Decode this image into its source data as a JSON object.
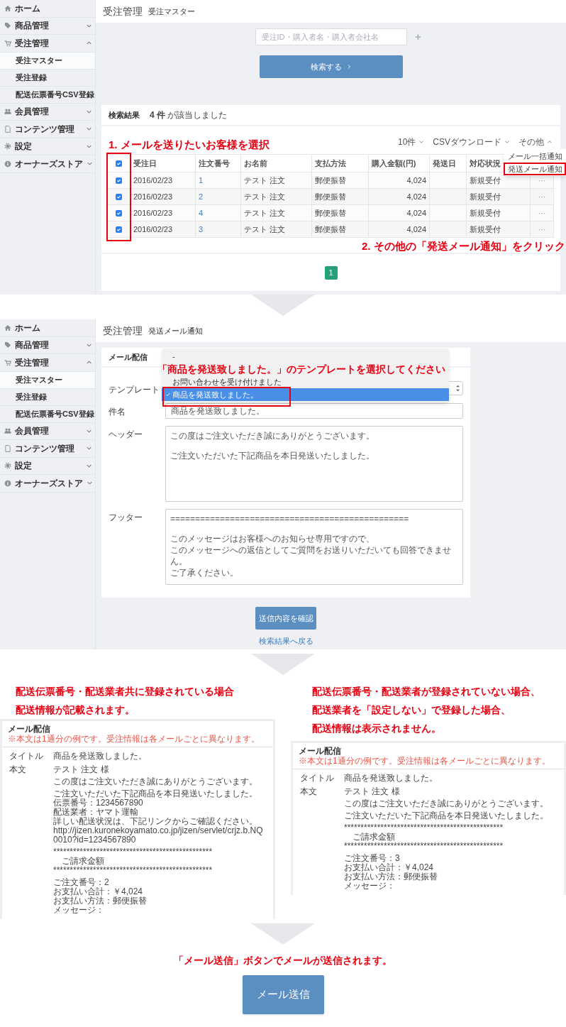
{
  "step1": {
    "sidebar": {
      "items": [
        {
          "label": "ホーム"
        },
        {
          "label": "商品管理",
          "expanded": false
        },
        {
          "label": "受注管理",
          "expanded": true,
          "children": [
            {
              "label": "受注マスター",
              "selected": true
            },
            {
              "label": "受注登録",
              "selected": false
            },
            {
              "label": "配送伝票番号CSV登録",
              "selected": false
            }
          ]
        },
        {
          "label": "会員管理",
          "expanded": false
        },
        {
          "label": "コンテンツ管理",
          "expanded": false
        },
        {
          "label": "設定",
          "expanded": false
        },
        {
          "label": "オーナーズストア",
          "expanded": false
        }
      ]
    },
    "breadcrumb": {
      "section": "受注管理",
      "page": "受注マスター"
    },
    "search": {
      "placeholder": "受注ID・購入者名・購入者会社名",
      "add_icon": "+",
      "button": "検索する"
    },
    "results": {
      "title": "検索結果",
      "summary": "**4 件** が該当しました",
      "toolbar": [
        {
          "label": "10件",
          "expanded": false
        },
        {
          "label": "CSVダウンロード",
          "expanded": false
        },
        {
          "label": "その他",
          "expanded": true
        }
      ],
      "menu": [
        {
          "label": "メール一括通知",
          "marked": false
        },
        {
          "label": "発送メール通知",
          "marked": true
        }
      ],
      "table": {
        "columns": [
          "受注日",
          "注文番号",
          "お名前",
          "支払方法",
          "購入金額(円)",
          "発送日",
          "対応状況"
        ],
        "header_checked": true,
        "checkbox_column_marked": true,
        "rows": [
          {
            "checked": true,
            "date": "2016/02/23",
            "number": "1",
            "name": "テスト 注文",
            "payment": "郵便振替",
            "amount": "4,024",
            "status": "新規受付",
            "more": "···"
          },
          {
            "checked": true,
            "date": "2016/02/23",
            "number": "2",
            "name": "テスト 注文",
            "payment": "郵便振替",
            "amount": "4,024",
            "status": "新規受付",
            "more": "···"
          },
          {
            "checked": true,
            "date": "2016/02/23",
            "number": "4",
            "name": "テスト 注文",
            "payment": "郵便振替",
            "amount": "4,024",
            "status": "新規受付",
            "more": "···"
          },
          {
            "checked": true,
            "date": "2016/02/23",
            "number": "3",
            "name": "テスト 注文",
            "payment": "郵便振替",
            "amount": "4,024",
            "status": "新規受付",
            "more": "···"
          }
        ]
      },
      "pages": [
        {
          "label": "1",
          "selected": true
        }
      ]
    },
    "annotations": [
      "1. メールを送りたいお客様を選択",
      "2. その他の「発送メール通知」をクリック"
    ]
  },
  "step2": {
    "sidebar": {
      "items": [
        {
          "label": "ホーム"
        },
        {
          "label": "商品管理",
          "expanded": false
        },
        {
          "label": "受注管理",
          "expanded": true,
          "children": [
            {
              "label": "受注マスター",
              "selected": true
            },
            {
              "label": "受注登録",
              "selected": false
            },
            {
              "label": "配送伝票番号CSV登録",
              "selected": false
            }
          ]
        },
        {
          "label": "会員管理",
          "expanded": false
        },
        {
          "label": "コンテンツ管理",
          "expanded": false
        },
        {
          "label": "設定",
          "expanded": false
        },
        {
          "label": "オーナーズストア",
          "expanded": false
        }
      ]
    },
    "breadcrumb": {
      "section": "受注管理",
      "page": "発送メール通知"
    },
    "form": {
      "title": "メール配信",
      "fields": [
        {
          "kind": "select",
          "label": "テンプレート",
          "open": true,
          "options": [
            {
              "label": "-",
              "selected": false,
              "marked": false
            },
            {
              "label": "お問い合わせを受け付けました",
              "selected": false,
              "marked": false
            },
            {
              "label": "商品を発送致しました。",
              "selected": true,
              "marked": true
            }
          ]
        },
        {
          "kind": "input",
          "label": "件名",
          "value": "商品を発送致しました。"
        },
        {
          "kind": "textarea",
          "label": "ヘッダー",
          "paragraphs": [
            [
              "この度はご注文いただき誠にありがとうございます。"
            ],
            [
              "ご注文いただいた下記商品を本日発送いたしました。"
            ]
          ]
        },
        {
          "kind": "textarea",
          "label": "フッター",
          "paragraphs": [
            [
              "================================================"
            ],
            [
              "このメッセージはお客様へのお知らせ専用ですので、",
              "このメッセージへの返信としてご質問をお送りいただいても回答できません。",
              "ご了承ください。"
            ]
          ]
        }
      ]
    },
    "annotation": "「商品を発送致しました。」のテンプレートを選択してください",
    "confirm_button": "送信内容を確認",
    "back_link": "検索結果へ戻る"
  },
  "step3": {
    "cases": [
      {
        "heading": [
          "配送伝票番号・配送業者共に登録されている場合",
          "配送情報が記載されます。"
        ],
        "mail": {
          "title": "メール配信",
          "note": "※本文は1通分の例です。受注情報は各メールごとに異なります。",
          "subject_label": "タイトル",
          "subject": "商品を発送致しました。",
          "body_label": "本文",
          "body": [
            [
              "テスト 注文 様"
            ],
            [
              "この度はご注文いただき誠にありがとうございます。"
            ],
            [
              "ご注文いただいた下記商品を本日発送いたしました。",
              "伝票番号：1234567890",
              "配送業者：ヤマト運輸",
              "詳しい配送状況は、下記リンクからご確認ください。",
              "http://jizen.kuronekoyamato.co.jp/jizen/servlet/crjz.b.NQ0010?id=1234567890"
            ],
            [
              "************************************************",
              "　ご請求金額",
              "************************************************"
            ],
            [
              "ご注文番号：2",
              "お支払い合計：￥4,024",
              "お支払い方法：郵便振替",
              "メッセージ："
            ]
          ]
        }
      },
      {
        "heading": [
          "配送伝票番号・配送業者が登録されていない場合、",
          "配送業者を「設定しない」で登録した場合、",
          "配送情報は表示されません。"
        ],
        "mail": {
          "title": "メール配信",
          "note": "※本文は1通分の例です。受注情報は各メールごとに異なります。",
          "subject_label": "タイトル",
          "subject": "商品を発送致しました。",
          "body_label": "本文",
          "body": [
            [
              "テスト 注文 様"
            ],
            [
              "この度はご注文いただき誠にありがとうございます。"
            ],
            [
              "ご注文いただいた下記商品を本日発送いたしました。"
            ],
            [
              "************************************************",
              "　ご請求金額",
              "************************************************"
            ],
            [
              "ご注文番号：3",
              "お支払い合計：￥4,024",
              "お支払い方法：郵便振替",
              "メッセージ："
            ]
          ]
        }
      }
    ]
  },
  "step4": {
    "caption": "「メール送信」ボタンでメールが送信されます。",
    "button": "メール送信"
  }
}
